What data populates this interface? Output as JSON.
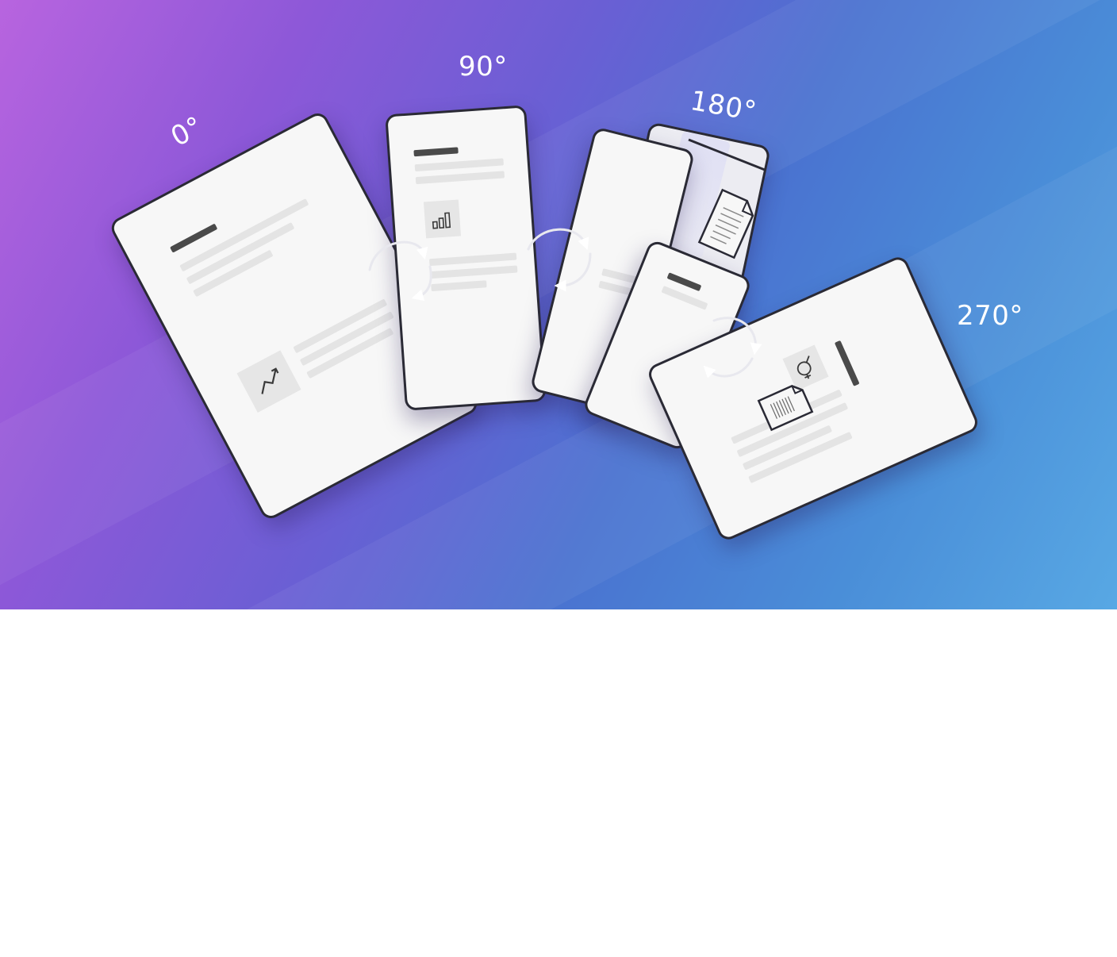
{
  "labels": {
    "rotation_0": "0°",
    "rotation_90": "90°",
    "rotation_180": "180°",
    "rotation_270": "270°"
  },
  "icons": {
    "page_1": "trend-chart-icon",
    "page_2": "bar-chart-icon",
    "page_4": "gender-symbol-icon",
    "floating": [
      "document-icon",
      "document-icon"
    ],
    "arrows": "rotate-arrow-icon"
  },
  "colors": {
    "page": "#f7f7f7",
    "outline": "#2a2a35",
    "background_start": "#b864df",
    "background_end": "#58a8e4"
  }
}
